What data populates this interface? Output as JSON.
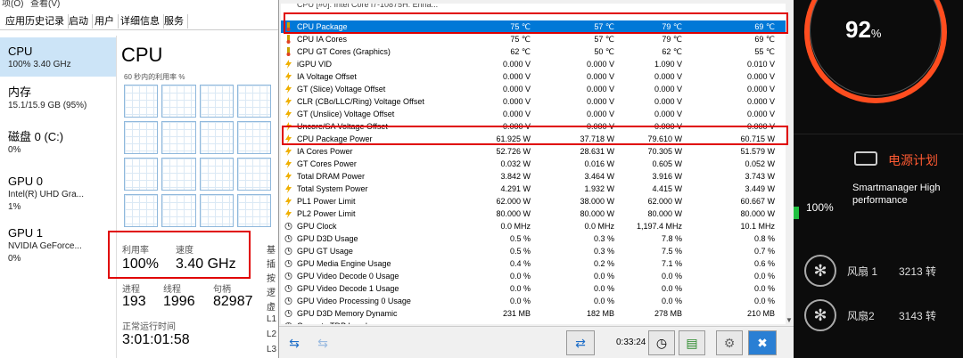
{
  "taskmgr": {
    "menu": [
      "项(O)",
      "查看(V)"
    ],
    "tabs": [
      "应用历史记录",
      "启动",
      "用户",
      "详细信息",
      "服务"
    ],
    "sidebar": [
      {
        "name": "CPU",
        "detail": "100%  3.40 GHz"
      },
      {
        "name": "内存",
        "detail": "15.1/15.9 GB (95%)"
      },
      {
        "name": "磁盘 0 (C:)",
        "detail": "0%"
      },
      {
        "name": "GPU 0",
        "detail": "Intel(R) UHD Gra...",
        "detail2": "1%"
      },
      {
        "name": "GPU 1",
        "detail": "NVIDIA GeForce...",
        "detail2": "0%"
      }
    ],
    "main": {
      "title": "CPU",
      "graph_label": "60 秒内的利用率 %",
      "util_label": "利用率",
      "util_value": "100%",
      "speed_label": "速度",
      "speed_value": "3.40 GHz",
      "proc_label": "进程",
      "proc_value": "193",
      "thread_label": "线程",
      "thread_value": "1996",
      "handle_label": "句柄",
      "handle_value": "82987",
      "uptime_label": "正常运行时间",
      "uptime_value": "3:01:01:58",
      "clipped": [
        "基",
        "插",
        "按",
        "逻",
        "虚",
        "L1",
        "L2",
        "L3"
      ]
    }
  },
  "hwinfo": {
    "header_row": "CPU [#0]: Intel Core i7-10875H: Enha...",
    "rows": [
      {
        "icon": "thermometer-icon",
        "name": "CPU Package",
        "v1": "75 ℃",
        "v2": "57 ℃",
        "v3": "79 ℃",
        "v4": "69 ℃",
        "selected": true
      },
      {
        "icon": "thermometer-icon",
        "name": "CPU IA Cores",
        "v1": "75 ℃",
        "v2": "57 ℃",
        "v3": "79 ℃",
        "v4": "69 ℃"
      },
      {
        "icon": "thermometer-icon",
        "name": "CPU GT Cores (Graphics)",
        "v1": "62 ℃",
        "v2": "50 ℃",
        "v3": "62 ℃",
        "v4": "55 ℃"
      },
      {
        "icon": "lightning-icon",
        "name": "iGPU VID",
        "v1": "0.000 V",
        "v2": "0.000 V",
        "v3": "1.090 V",
        "v4": "0.010 V"
      },
      {
        "icon": "lightning-icon",
        "name": "IA Voltage Offset",
        "v1": "0.000 V",
        "v2": "0.000 V",
        "v3": "0.000 V",
        "v4": "0.000 V"
      },
      {
        "icon": "lightning-icon",
        "name": "GT (Slice) Voltage Offset",
        "v1": "0.000 V",
        "v2": "0.000 V",
        "v3": "0.000 V",
        "v4": "0.000 V"
      },
      {
        "icon": "lightning-icon",
        "name": "CLR (CBo/LLC/Ring) Voltage Offset",
        "v1": "0.000 V",
        "v2": "0.000 V",
        "v3": "0.000 V",
        "v4": "0.000 V"
      },
      {
        "icon": "lightning-icon",
        "name": "GT (Unslice) Voltage Offset",
        "v1": "0.000 V",
        "v2": "0.000 V",
        "v3": "0.000 V",
        "v4": "0.000 V"
      },
      {
        "icon": "lightning-icon",
        "name": "Uncore/SA Voltage Offset",
        "v1": "0.000 V",
        "v2": "0.000 V",
        "v3": "0.000 V",
        "v4": "0.000 V"
      },
      {
        "icon": "lightning-icon",
        "name": "CPU Package Power",
        "v1": "61.925 W",
        "v2": "37.718 W",
        "v3": "79.610 W",
        "v4": "60.715 W"
      },
      {
        "icon": "lightning-icon",
        "name": "IA Cores Power",
        "v1": "52.726 W",
        "v2": "28.631 W",
        "v3": "70.305 W",
        "v4": "51.579 W"
      },
      {
        "icon": "lightning-icon",
        "name": "GT Cores Power",
        "v1": "0.032 W",
        "v2": "0.016 W",
        "v3": "0.605 W",
        "v4": "0.052 W"
      },
      {
        "icon": "lightning-icon",
        "name": "Total DRAM Power",
        "v1": "3.842 W",
        "v2": "3.464 W",
        "v3": "3.916 W",
        "v4": "3.743 W"
      },
      {
        "icon": "lightning-icon",
        "name": "Total System Power",
        "v1": "4.291 W",
        "v2": "1.932 W",
        "v3": "4.415 W",
        "v4": "3.449 W"
      },
      {
        "icon": "lightning-icon",
        "name": "PL1 Power Limit",
        "v1": "62.000 W",
        "v2": "38.000 W",
        "v3": "62.000 W",
        "v4": "60.667 W"
      },
      {
        "icon": "lightning-icon",
        "name": "PL2 Power Limit",
        "v1": "80.000 W",
        "v2": "80.000 W",
        "v3": "80.000 W",
        "v4": "80.000 W"
      },
      {
        "icon": "clock-icon",
        "name": "GPU Clock",
        "v1": "0.0 MHz",
        "v2": "0.0 MHz",
        "v3": "1,197.4 MHz",
        "v4": "10.1 MHz"
      },
      {
        "icon": "clock-icon",
        "name": "GPU D3D Usage",
        "v1": "0.5 %",
        "v2": "0.3 %",
        "v3": "7.8 %",
        "v4": "0.8 %"
      },
      {
        "icon": "clock-icon",
        "name": "GPU GT Usage",
        "v1": "0.5 %",
        "v2": "0.3 %",
        "v3": "7.5 %",
        "v4": "0.7 %"
      },
      {
        "icon": "clock-icon",
        "name": "GPU Media Engine Usage",
        "v1": "0.4 %",
        "v2": "0.2 %",
        "v3": "7.1 %",
        "v4": "0.6 %"
      },
      {
        "icon": "clock-icon",
        "name": "GPU Video Decode 0 Usage",
        "v1": "0.0 %",
        "v2": "0.0 %",
        "v3": "0.0 %",
        "v4": "0.0 %"
      },
      {
        "icon": "clock-icon",
        "name": "GPU Video Decode 1 Usage",
        "v1": "0.0 %",
        "v2": "0.0 %",
        "v3": "0.0 %",
        "v4": "0.0 %"
      },
      {
        "icon": "clock-icon",
        "name": "GPU Video Processing 0 Usage",
        "v1": "0.0 %",
        "v2": "0.0 %",
        "v3": "0.0 %",
        "v4": "0.0 %"
      },
      {
        "icon": "clock-icon",
        "name": "GPU D3D Memory Dynamic",
        "v1": "231 MB",
        "v2": "182 MB",
        "v3": "278 MB",
        "v4": "210 MB"
      },
      {
        "icon": "clock-icon",
        "name": "Current cTDP Level",
        "v1": "",
        "v2": "",
        "v3": "",
        "v4": ""
      }
    ],
    "elapsed": "0:33:24"
  },
  "right": {
    "cpu_percent": "92",
    "percent_sign": "%",
    "power_title": "电源计划",
    "plan_name": "Smartmanager High performance",
    "left_percent": "100%",
    "fan1_label": "风扇 1",
    "fan1_rpm": "3213 转",
    "fan2_label": "风扇2",
    "fan2_rpm": "3143 转"
  },
  "colors": {
    "highlight_red": "#e00000",
    "selection_blue": "#0078d7",
    "gauge_orange": "#ff4d1f"
  }
}
